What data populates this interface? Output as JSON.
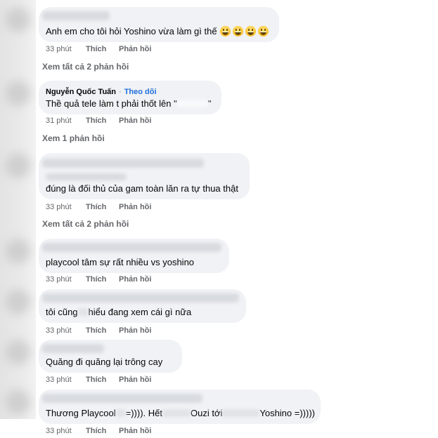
{
  "actions": {
    "like": "Thích",
    "reply": "Phản hồi"
  },
  "comments": [
    {
      "text": "Anh em cho tôi hỏi Yoshino vừa làm gì thế",
      "emoji": [
        "grinning-face-icon",
        "grinning-face-icon",
        "grinning-face-icon",
        "grinning-face-icon"
      ],
      "time": "33 phút",
      "view_replies": "Xem tất cả 2 phản hồi"
    },
    {
      "author": "Nguyễn Quốc Tuấn",
      "separator": "·",
      "follow": "Theo dõi",
      "text_parts": [
        "Thề quả tele làm t phải thốt lên \"",
        "\""
      ],
      "time": "31 phút",
      "view_replies": "Xem 1 phản hồi"
    },
    {
      "text": "đúng là đối thủ của gam toàn lăn ra tự thua thật",
      "time": "33 phút",
      "view_replies": "Xem tất cả 2 phản hồi"
    },
    {
      "text": "playcool tâm sự rất nhiều vs yoshino",
      "time": "33 phút"
    },
    {
      "text_parts": [
        "tôi cũng",
        "hiểu đang xem cái gì nữa"
      ],
      "time": "33 phút"
    },
    {
      "text": "Quăng đi quăng lại trông cay",
      "time": "33 phút"
    },
    {
      "text_parts": [
        "Thương Playcool",
        "=)))). Hết",
        "Ouzi tới",
        "Yoshino =)))))"
      ],
      "time": "33 phút"
    }
  ],
  "colors": {
    "bubble": "#f0f2f5",
    "text": "#050505",
    "meta": "#65676b",
    "follow_link": "#216fdb"
  }
}
